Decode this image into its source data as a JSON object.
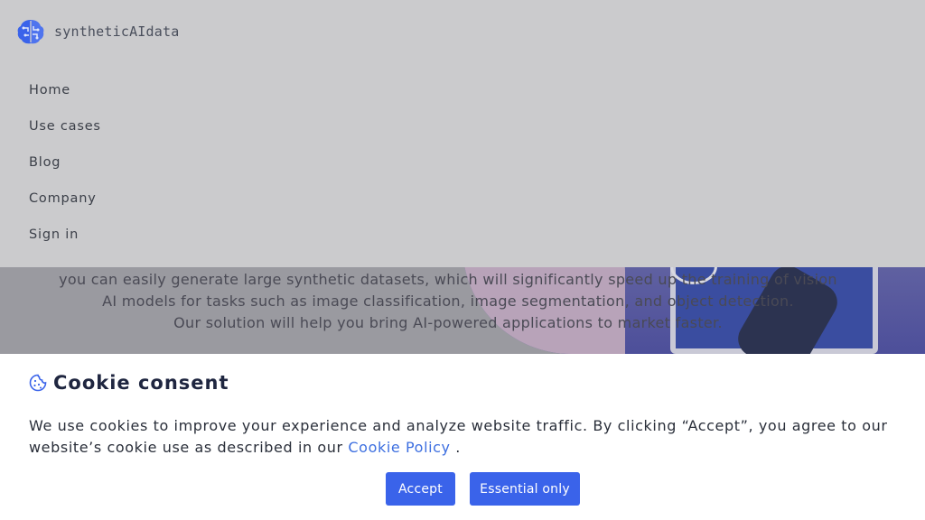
{
  "brand": {
    "name": "syntheticAIdata",
    "logo_icon": "brain-circuit-icon",
    "logo_color": "#3a63ea"
  },
  "nav": {
    "items": [
      {
        "label": "Home"
      },
      {
        "label": "Use cases"
      },
      {
        "label": "Blog"
      },
      {
        "label": "Company"
      },
      {
        "label": "Sign in"
      }
    ]
  },
  "hero": {
    "lines": [
      "you can easily generate large synthetic datasets, which will significantly speed up the training of vision",
      "AI models for tasks such as image classification, image segmentation, and object detection.",
      "Our solution will help you bring AI-powered applications to market faster."
    ]
  },
  "cookie": {
    "icon": "cookie-icon",
    "title": "Cookie consent",
    "body_text": "We use cookies to improve your experience and analyze website traffic. By clicking “Accept”, you agree to our website’s cookie use as described in our ",
    "link_label": "Cookie Policy",
    "body_end": " .",
    "accept_label": "Accept",
    "essential_label": "Essential only",
    "accent_color": "#3a63ea"
  }
}
